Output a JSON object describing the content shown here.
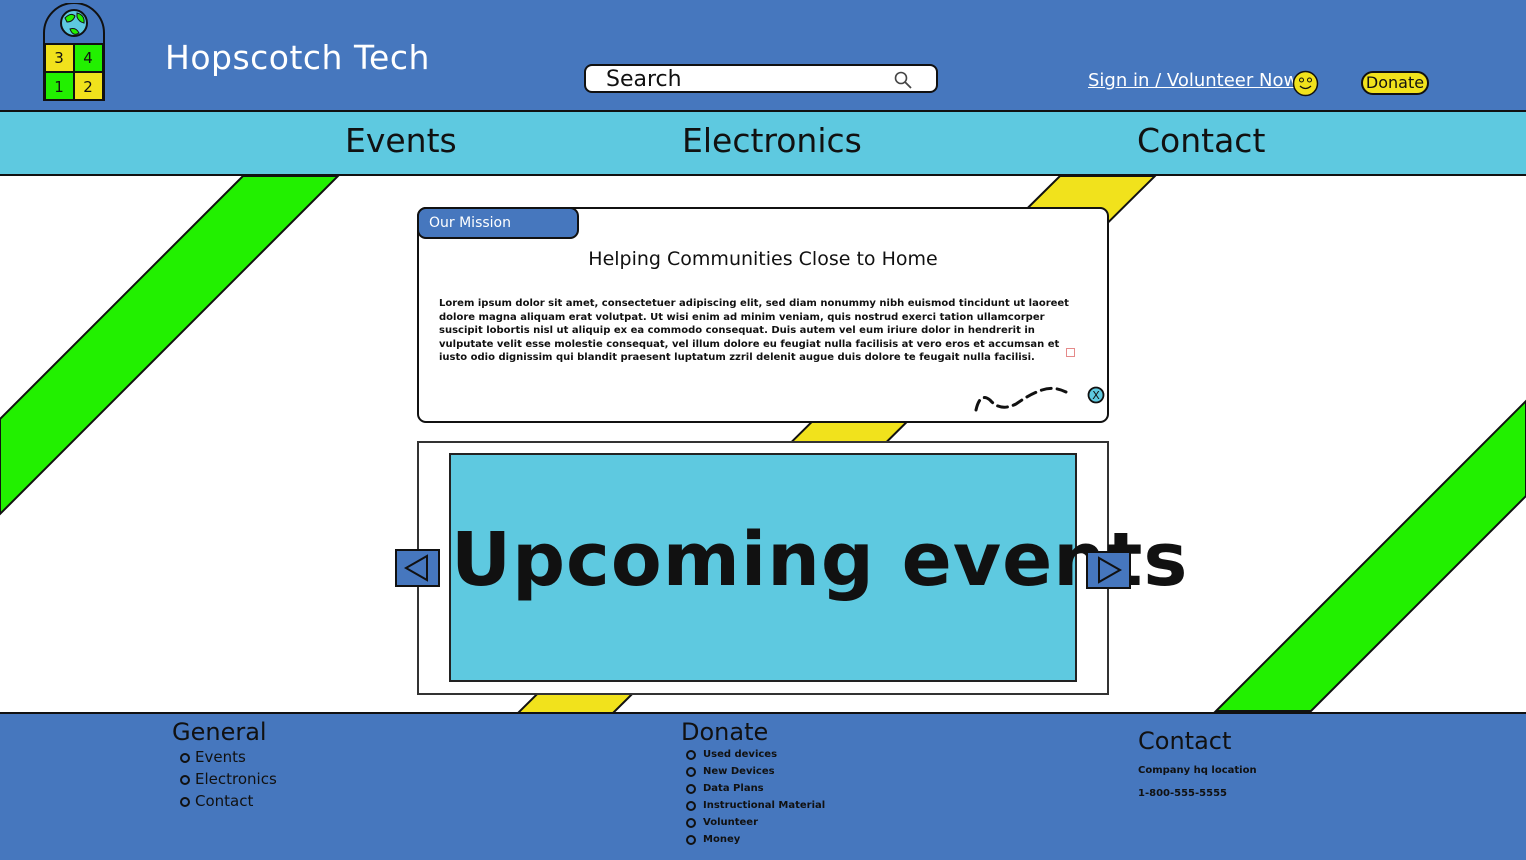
{
  "header": {
    "title": "Hopscotch Tech",
    "search_placeholder": "Search",
    "signin_label": "Sign in / Volunteer Now",
    "donate_label": "Donate",
    "logo_numbers": [
      "3",
      "4",
      "1",
      "2"
    ]
  },
  "nav": {
    "items": [
      {
        "label": "Events"
      },
      {
        "label": "Electronics"
      },
      {
        "label": "Contact"
      }
    ]
  },
  "mission": {
    "tab_label": "Our Mission",
    "heading": "Helping Communities Close to Home",
    "body": "Lorem ipsum dolor sit amet, consectetuer adipiscing elit, sed diam nonummy nibh euismod tincidunt ut laoreet dolore magna aliquam erat volutpat. Ut wisi enim ad minim veniam, quis nostrud exerci tation ullamcorper suscipit lobortis nisl ut aliquip ex ea commodo consequat. Duis autem vel eum iriure dolor in hendrerit in vulputate velit esse molestie consequat, vel illum dolore eu feugiat nulla facilisis at vero eros et accumsan et iusto odio dignissim qui blandit praesent luptatum zzril delenit augue duis dolore te feugait nulla facilisi.",
    "close_glyph": "X"
  },
  "events": {
    "title": "Upcoming events"
  },
  "footer": {
    "general": {
      "heading": "General",
      "items": [
        "Events",
        "Electronics",
        "Contact"
      ]
    },
    "donate": {
      "heading": "Donate",
      "items": [
        "Used devices",
        "New Devices",
        "Data Plans",
        "Instructional Material",
        "Volunteer",
        "Money"
      ]
    },
    "contact": {
      "heading": "Contact",
      "location": "Company hq location",
      "phone": "1-800-555-5555"
    }
  },
  "colors": {
    "header_blue": "#4677be",
    "nav_cyan": "#5ec9e0",
    "stripe_green": "#22f000",
    "stripe_yellow": "#f1e21c"
  },
  "icons": {
    "logo": "globe-hopscotch-logo",
    "search": "search-icon",
    "smiley": "smiley-icon",
    "prev": "arrow-left-icon",
    "next": "arrow-right-icon",
    "close": "close-icon"
  }
}
